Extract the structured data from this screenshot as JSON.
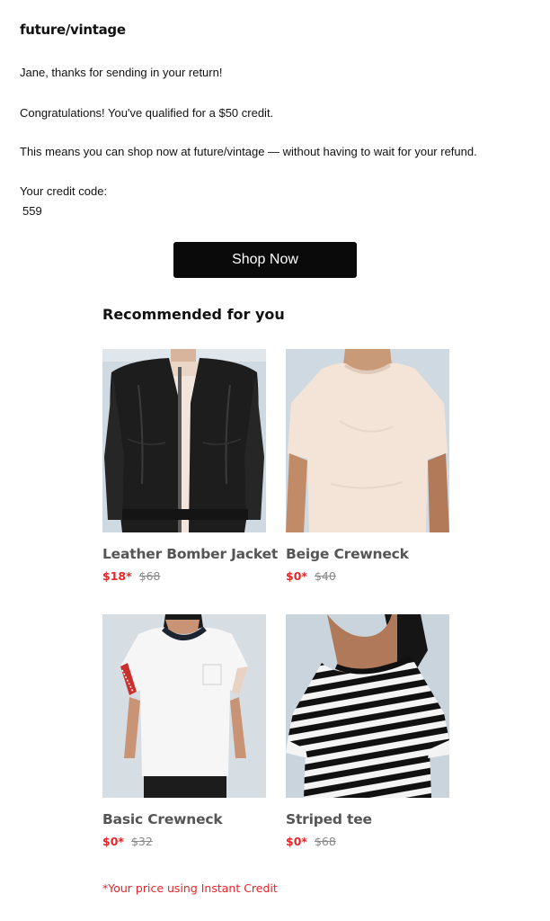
{
  "brand": "future/vintage",
  "message": {
    "greeting": "Jane, thanks for sending in your return!",
    "congrats": "Congratulations! You've qualified for a $50 credit.",
    "explain": "This means you can shop now at future/vintage — without having to wait for your refund.",
    "code_label": "Your credit code:",
    "code_value": "559"
  },
  "cta": {
    "label": "Shop Now"
  },
  "recommendations": {
    "title": "Recommended for you",
    "items": [
      {
        "name": "Leather Bomber Jacket",
        "price": "$18*",
        "original_price": "$68",
        "image": "jacket-photo"
      },
      {
        "name": "Beige Crewneck",
        "price": "$0*",
        "original_price": "$40",
        "image": "beige-tee-photo"
      },
      {
        "name": "Basic Crewneck",
        "price": "$0*",
        "original_price": "$32",
        "image": "white-tee-photo"
      },
      {
        "name": "Striped tee",
        "price": "$0*",
        "original_price": "$68",
        "image": "striped-tee-photo"
      }
    ]
  },
  "footnote": "*Your price using Instant Credit",
  "colors": {
    "accent": "#e5262a",
    "button": "#0a0a0a",
    "muted": "#8a8a8a"
  }
}
